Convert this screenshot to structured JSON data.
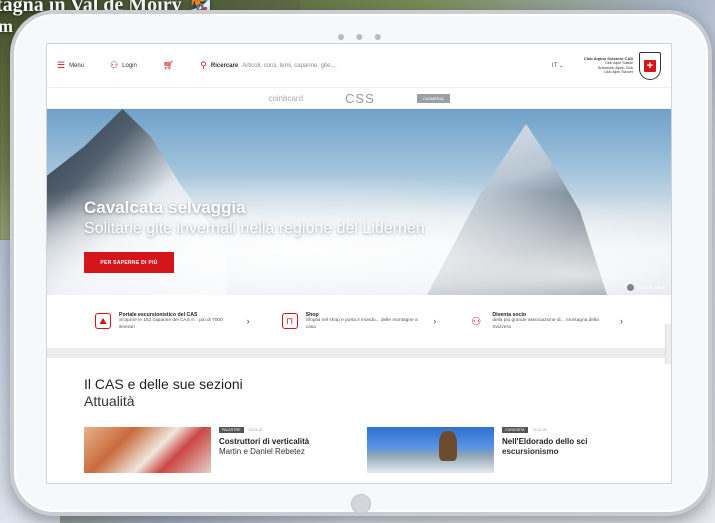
{
  "background": {
    "caption_line1": "tagna in Val de Moiry 🏂",
    "caption_line2": "m"
  },
  "tablet": {
    "camera_dots": "● ● ●"
  },
  "nav": {
    "menu_label": "Menu",
    "login_label": "Login",
    "search_label": "Ricercare",
    "search_placeholder": "Articoli, corsi, temi, capanne, gite,...",
    "lang": "IT",
    "lang_caret": "⌄",
    "org_lines": [
      "Club Alpino Svizzero CAS",
      "Club Alpin Suisse",
      "Schweizer Alpen-Club",
      "Club Alpin Svizzer"
    ]
  },
  "sponsors": {
    "first": "coinbcard",
    "second": "CSS",
    "third": "CASMEDIA"
  },
  "hero": {
    "title": "Cavalcata selvaggia",
    "subtitle": "Solitarie gite invernali nella regione del Lidernen",
    "button": "PER SAPERNE DI PIÙ",
    "credit": "© Kevin Wenk"
  },
  "promos": [
    {
      "icon": "mountain-icon",
      "title": "Portale escursionistico del CAS",
      "text": "Scoprire le 152 capanne del CAS e... più di 7000 itinerari"
    },
    {
      "icon": "shop-bag-icon",
      "title": "Shop",
      "text": "Sfoglia nel shop e porta il mondo... delle montagne a casa"
    },
    {
      "icon": "member-icon",
      "title": "Diventa socio",
      "text": "della più grande associazione di... montagna della Svizzera"
    }
  ],
  "news": {
    "heading": "Il CAS e delle sue sezioni",
    "subheading": "Attualità",
    "cards": [
      {
        "tag": "PALESTRE",
        "date": "25.01.25",
        "title": "Costruttori di verticalità",
        "subtitle": "Martin e Daniel Rebetez"
      },
      {
        "tag": "CURIOSITÀ",
        "date": "24.01.25",
        "title": "Nell'Eldorado dello sci",
        "subtitle": "escursionismo"
      }
    ]
  },
  "colors": {
    "accent_red": "#d4161c"
  }
}
